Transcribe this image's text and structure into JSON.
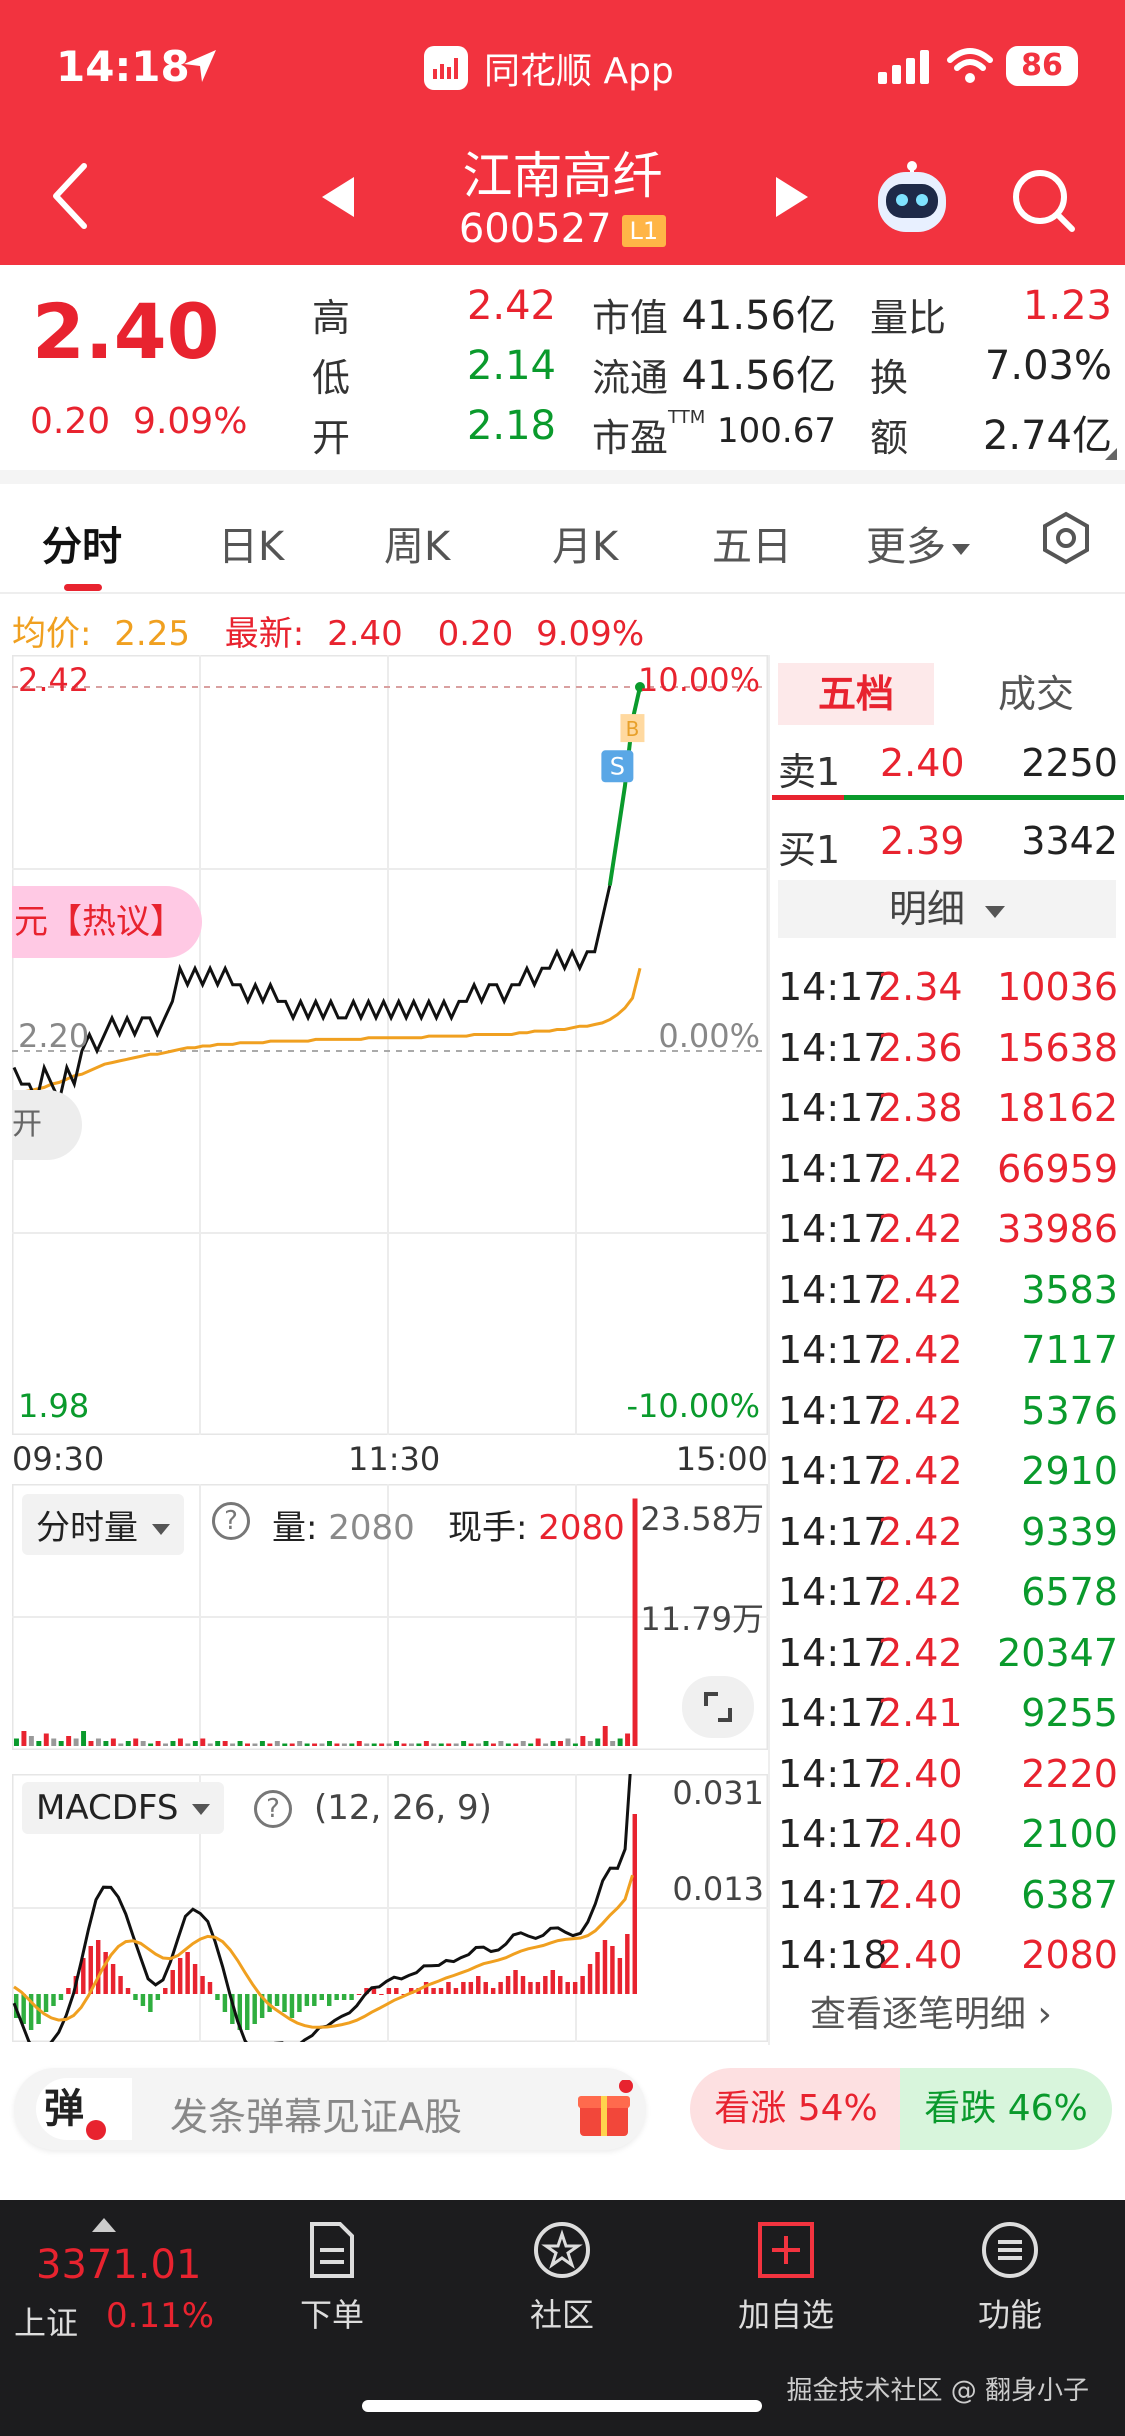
{
  "status": {
    "time": "14:18",
    "app": "同花顺 App",
    "battery": "86"
  },
  "stock": {
    "name": "江南高纤",
    "code": "600527",
    "level": "L1"
  },
  "quote": {
    "price": "2.40",
    "change": "0.20",
    "change_pct": "9.09%",
    "high_label": "高",
    "high": "2.42",
    "low_label": "低",
    "low": "2.14",
    "open_label": "开",
    "open": "2.18",
    "mcap_label": "市值",
    "mcap": "41.56亿",
    "float_label": "流通",
    "float": "41.56亿",
    "pe_label": "市盈",
    "pe_sup": "TTM",
    "pe": "100.67",
    "vol_ratio_label": "量比",
    "vol_ratio": "1.23",
    "turnover_label": "换",
    "turnover": "7.03%",
    "amount_label": "额",
    "amount": "2.74亿"
  },
  "tabs": [
    "分时",
    "日K",
    "周K",
    "月K",
    "五日",
    "更多"
  ],
  "avg_row": {
    "avg_label": "均价:",
    "avg": "2.25",
    "latest_label": "最新:",
    "latest": "2.40",
    "chg": "0.20",
    "pct": "9.09%"
  },
  "chart_data": {
    "type": "line",
    "title": "",
    "x_ticks": [
      "09:30",
      "11:30",
      "15:00"
    ],
    "y_left_ticks": [
      "2.42",
      "2.20",
      "1.98"
    ],
    "y_right_ticks": [
      "10.00%",
      "0.00%",
      "-10.00%"
    ],
    "ylim": [
      1.98,
      2.42
    ],
    "prev_close": 2.2,
    "series": [
      {
        "values": [
          2.19,
          2.18,
          2.18,
          2.17,
          2.19,
          2.18,
          2.17,
          2.19,
          2.18,
          2.2,
          2.21,
          2.2,
          2.21,
          2.22,
          2.21,
          2.22,
          2.21,
          2.22,
          2.22,
          2.21,
          2.22,
          2.23,
          2.25,
          2.24,
          2.25,
          2.24,
          2.25,
          2.24,
          2.25,
          2.24,
          2.24,
          2.23,
          2.24,
          2.23,
          2.24,
          2.23,
          2.23,
          2.22,
          2.23,
          2.22,
          2.23,
          2.22,
          2.23,
          2.22,
          2.22,
          2.23,
          2.22,
          2.23,
          2.22,
          2.23,
          2.22,
          2.23,
          2.22,
          2.23,
          2.22,
          2.23,
          2.22,
          2.23,
          2.22,
          2.23,
          2.23,
          2.24,
          2.23,
          2.24,
          2.24,
          2.23,
          2.24,
          2.24,
          2.25,
          2.24,
          2.25,
          2.25,
          2.26,
          2.25,
          2.26,
          2.25,
          2.26,
          2.26,
          2.28,
          2.3,
          2.33,
          2.36,
          2.4,
          2.42
        ]
      },
      {
        "values": [
          2.175,
          2.175,
          2.176,
          2.177,
          2.178,
          2.18,
          2.181,
          2.183,
          2.185,
          2.186,
          2.188,
          2.19,
          2.192,
          2.193,
          2.194,
          2.195,
          2.196,
          2.197,
          2.198,
          2.198,
          2.199,
          2.2,
          2.201,
          2.202,
          2.202,
          2.203,
          2.203,
          2.204,
          2.204,
          2.204,
          2.205,
          2.205,
          2.205,
          2.205,
          2.206,
          2.206,
          2.206,
          2.206,
          2.206,
          2.206,
          2.207,
          2.207,
          2.207,
          2.207,
          2.207,
          2.207,
          2.207,
          2.208,
          2.208,
          2.208,
          2.208,
          2.208,
          2.208,
          2.208,
          2.208,
          2.209,
          2.209,
          2.209,
          2.209,
          2.209,
          2.209,
          2.21,
          2.21,
          2.21,
          2.21,
          2.21,
          2.21,
          2.211,
          2.211,
          2.212,
          2.212,
          2.212,
          2.213,
          2.213,
          2.214,
          2.215,
          2.215,
          2.216,
          2.217,
          2.219,
          2.222,
          2.226,
          2.232,
          2.25
        ]
      }
    ],
    "markers": [
      "B",
      "S"
    ]
  },
  "hot_topic": "元【热议】",
  "open_marker": "开",
  "volume": {
    "selector": "分时量",
    "vol_label": "量:",
    "vol": "2080",
    "hand_label": "现手:",
    "hand": "2080",
    "ticks": [
      "23.58万",
      "11.79万"
    ],
    "bars": [
      3,
      6,
      4,
      2,
      5,
      3,
      2,
      4,
      3,
      6,
      2,
      3,
      2,
      3,
      1,
      2,
      3,
      2,
      1,
      2,
      1,
      2,
      3,
      1,
      2,
      3,
      1,
      2,
      2,
      1,
      2,
      1,
      1,
      2,
      1,
      2,
      1,
      1,
      2,
      1,
      1,
      1,
      2,
      1,
      1,
      1,
      2,
      1,
      1,
      1,
      1,
      2,
      1,
      1,
      1,
      2,
      1,
      1,
      1,
      1,
      2,
      1,
      1,
      2,
      1,
      2,
      1,
      1,
      2,
      1,
      3,
      1,
      2,
      2,
      3,
      1,
      4,
      2,
      3,
      8,
      2,
      3,
      5,
      99
    ]
  },
  "macd": {
    "selector": "MACDFS",
    "params": "(12, 26, 9)",
    "ticks": [
      "0.031",
      "0.013"
    ],
    "hist": [
      -4,
      -5,
      -6,
      -5,
      -3,
      -2,
      -1,
      1,
      3,
      6,
      8,
      9,
      7,
      5,
      3,
      1,
      -1,
      -2,
      -3,
      -1,
      1,
      4,
      6,
      7,
      5,
      3,
      2,
      -1,
      -3,
      -5,
      -6,
      -6,
      -5,
      -4,
      -3,
      -2,
      -3,
      -4,
      -3,
      -2,
      -2,
      -1,
      -2,
      -1,
      -1,
      -1,
      0,
      1,
      1,
      0,
      1,
      1,
      0,
      1,
      1,
      2,
      1,
      1,
      2,
      1,
      2,
      2,
      3,
      2,
      1,
      2,
      3,
      4,
      3,
      2,
      2,
      3,
      4,
      3,
      2,
      2,
      3,
      5,
      7,
      9,
      8,
      6,
      10,
      30
    ]
  },
  "orderbook": {
    "tab_five": "五档",
    "tab_deals": "成交",
    "sell_label": "卖1",
    "sell_price": "2.40",
    "sell_qty": "2250",
    "buy_label": "买1",
    "buy_price": "2.39",
    "buy_qty": "3342",
    "detail": "明细",
    "ticks": [
      {
        "t": "14:17",
        "p": "2.34",
        "v": "10036",
        "c": "red"
      },
      {
        "t": "14:17",
        "p": "2.36",
        "v": "15638",
        "c": "red"
      },
      {
        "t": "14:17",
        "p": "2.38",
        "v": "18162",
        "c": "red"
      },
      {
        "t": "14:17",
        "p": "2.42",
        "v": "66959",
        "c": "red"
      },
      {
        "t": "14:17",
        "p": "2.42",
        "v": "33986",
        "c": "red"
      },
      {
        "t": "14:17",
        "p": "2.42",
        "v": "3583",
        "c": "green"
      },
      {
        "t": "14:17",
        "p": "2.42",
        "v": "7117",
        "c": "green"
      },
      {
        "t": "14:17",
        "p": "2.42",
        "v": "5376",
        "c": "green"
      },
      {
        "t": "14:17",
        "p": "2.42",
        "v": "2910",
        "c": "green"
      },
      {
        "t": "14:17",
        "p": "2.42",
        "v": "9339",
        "c": "green"
      },
      {
        "t": "14:17",
        "p": "2.42",
        "v": "6578",
        "c": "green"
      },
      {
        "t": "14:17",
        "p": "2.42",
        "v": "20347",
        "c": "green"
      },
      {
        "t": "14:17",
        "p": "2.41",
        "v": "9255",
        "c": "green"
      },
      {
        "t": "14:17",
        "p": "2.40",
        "v": "2220",
        "c": "red"
      },
      {
        "t": "14:17",
        "p": "2.40",
        "v": "2100",
        "c": "green"
      },
      {
        "t": "14:17",
        "p": "2.40",
        "v": "6387",
        "c": "green"
      },
      {
        "t": "14:18",
        "p": "2.40",
        "v": "2080",
        "c": "red"
      }
    ],
    "more": "查看逐笔明细 ›"
  },
  "barrage": {
    "icon": "弹",
    "placeholder": "发条弹幕见证A股",
    "bull": "看涨 54%",
    "bear": "看跌 46%"
  },
  "bottom": {
    "index_value": "3371.01",
    "index_name": "上证",
    "index_pct": "0.11%",
    "nav": [
      "下单",
      "社区",
      "加自选",
      "功能"
    ],
    "watermark": "掘金技术社区 @ 翻身小子"
  },
  "colors": {
    "brand": "#f2333f",
    "up": "#e8232f",
    "down": "#0a9a2c",
    "avg_line": "#f0a020"
  }
}
